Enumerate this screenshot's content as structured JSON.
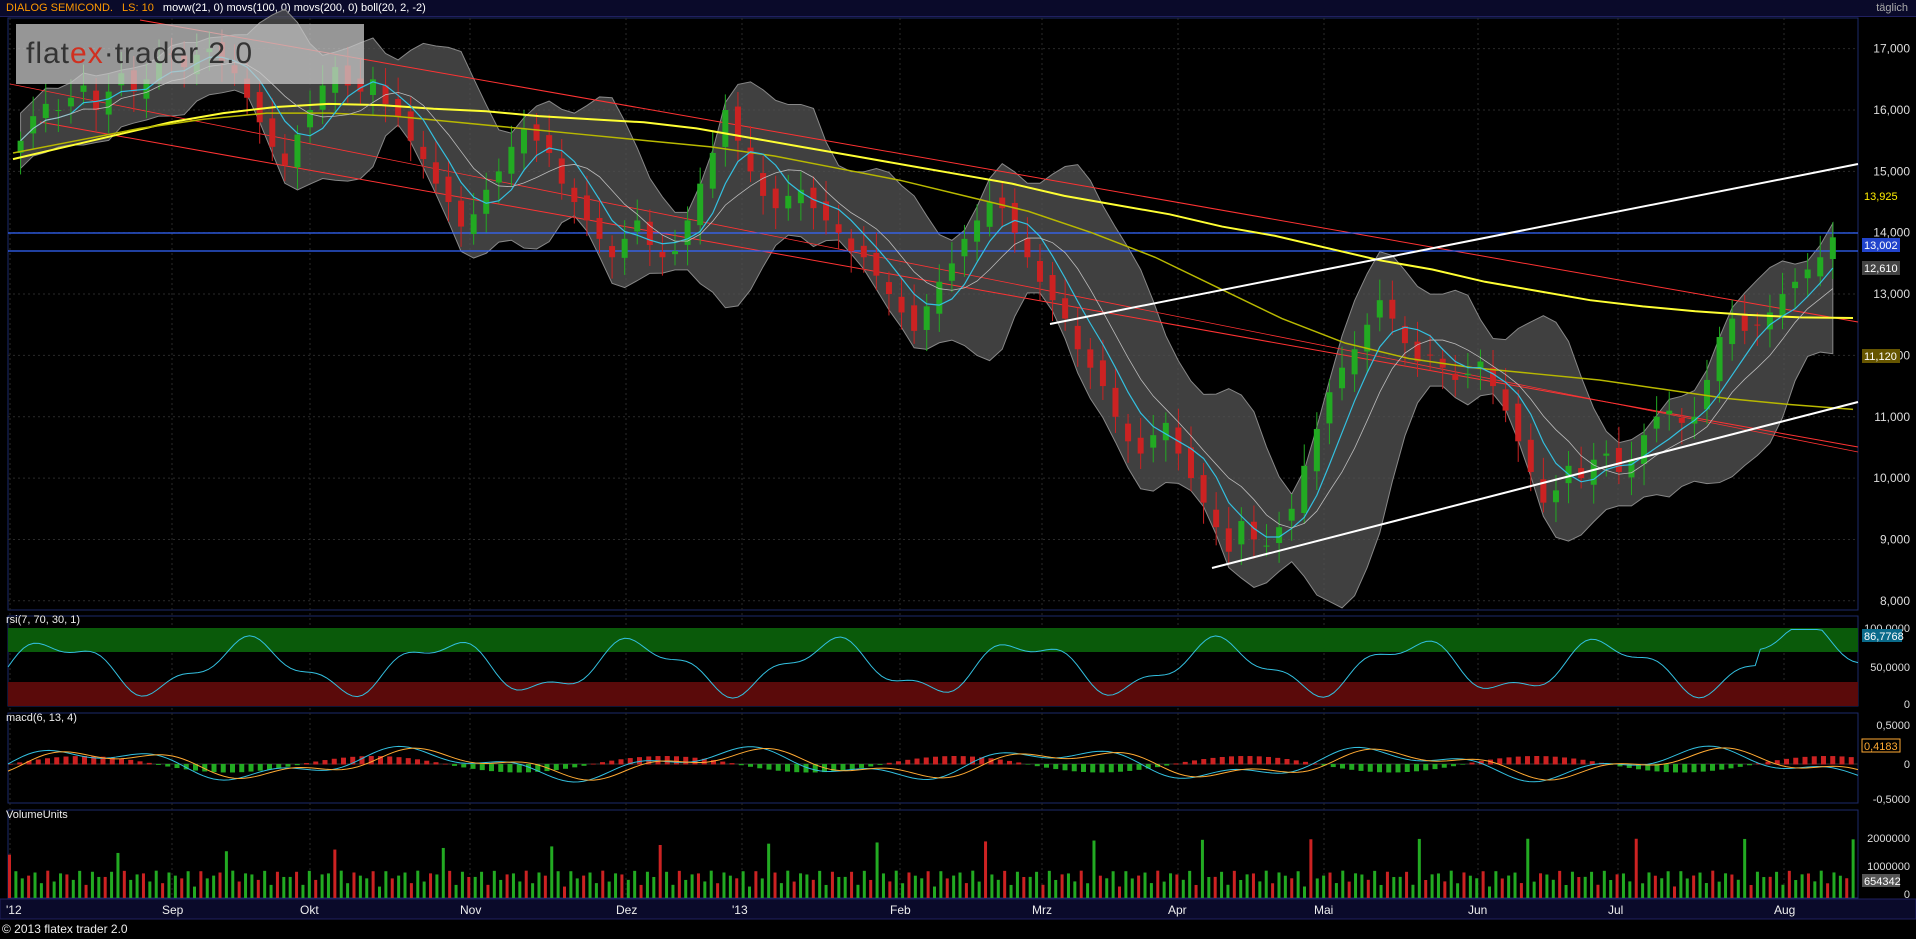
{
  "header": {
    "symbol": "DIALOG SEMICOND.",
    "ls": "LS: 10",
    "indicators": "movw(21, 0) movs(100, 0) movs(200, 0) boll(20, 2, -2)",
    "frequency": "täglich"
  },
  "logo": {
    "part1": "flat",
    "part2": "ex",
    "part3": "·trader 2.0"
  },
  "footer": "© 2013 flatex trader 2.0",
  "colors": {
    "up": "#22aa22",
    "down": "#cc2222",
    "sma100": "#b8b800",
    "sma200": "#ffff33",
    "wma21": "#33c0e0",
    "channel": "#ff3333",
    "hline": "#3366ff",
    "trend": "#ffffff"
  },
  "panels": {
    "rsi": {
      "label": "rsi(7, 70, 30, 1)",
      "ticks": [
        "50,0000",
        "0"
      ],
      "top_tick": "100,0000",
      "value": "86,7768"
    },
    "macd": {
      "label": "macd(6, 13, 4)",
      "ticks": [
        "0,5000",
        "0",
        "-0,5000"
      ],
      "value": "0,4183"
    },
    "volume": {
      "label": "VolumeUnits",
      "ticks": [
        "2000000",
        "1000000",
        "0"
      ],
      "value": "654342"
    }
  },
  "chart_data": {
    "type": "candlestick",
    "x_months": [
      "'12",
      "Sep",
      "Okt",
      "Nov",
      "Dez",
      "'13",
      "Feb",
      "Mrz",
      "Apr",
      "Mai",
      "Jun",
      "Jul",
      "Aug"
    ],
    "y_ticks": [
      "17,000",
      "16,000",
      "15,000",
      "14,000",
      "13,000",
      "12,000",
      "11,000",
      "10,000",
      "9,000",
      "8,000"
    ],
    "ylim": [
      7.85,
      17.5
    ],
    "price_labels": {
      "last": "13,925",
      "hline": "13,002",
      "sma200": "12,610",
      "sma100": "11,120"
    },
    "closes": [
      15.5,
      15.9,
      16.1,
      16.0,
      16.2,
      16.4,
      16.0,
      16.3,
      16.6,
      16.3,
      16.5,
      16.8,
      16.9,
      16.7,
      16.9,
      17.0,
      16.8,
      16.6,
      16.2,
      15.8,
      15.4,
      15.1,
      15.6,
      16.0,
      16.4,
      16.7,
      16.4,
      16.3,
      16.5,
      16.1,
      15.9,
      15.5,
      15.2,
      14.8,
      14.5,
      14.1,
      14.3,
      14.7,
      15.0,
      15.4,
      15.7,
      15.5,
      15.3,
      14.8,
      14.5,
      14.2,
      13.9,
      13.6,
      13.9,
      14.2,
      13.8,
      13.6,
      13.7,
      14.2,
      14.8,
      15.3,
      16.0,
      15.5,
      15.0,
      14.6,
      14.4,
      14.6,
      14.7,
      14.4,
      14.2,
      14.0,
      13.7,
      13.6,
      13.3,
      13.0,
      12.7,
      12.4,
      12.8,
      13.2,
      13.5,
      13.9,
      14.2,
      14.5,
      14.4,
      14.0,
      13.6,
      13.2,
      12.9,
      12.6,
      12.1,
      11.8,
      11.5,
      11.0,
      10.6,
      10.4,
      10.7,
      10.9,
      10.4,
      10.0,
      9.6,
      9.2,
      8.8,
      9.3,
      9.0,
      8.9,
      9.2,
      9.5,
      10.2,
      10.8,
      11.4,
      11.8,
      12.1,
      12.5,
      12.9,
      12.6,
      12.2,
      11.9,
      12.0,
      11.8,
      11.6,
      11.7,
      11.9,
      11.5,
      11.1,
      10.6,
      10.1,
      9.6,
      9.8,
      10.2,
      10.0,
      10.3,
      10.4,
      10.1,
      10.3,
      10.7,
      11.0,
      11.1,
      10.9,
      11.0,
      11.6,
      12.3,
      12.6,
      12.4,
      12.5,
      12.7,
      13.0,
      13.2,
      13.4,
      13.6,
      13.925
    ],
    "sma200": [
      15.2,
      15.4,
      15.6,
      15.8,
      15.95,
      16.05,
      16.1,
      16.08,
      16.02,
      15.98,
      15.9,
      15.85,
      15.8,
      15.7,
      15.55,
      15.4,
      15.25,
      15.1,
      14.95,
      14.8,
      14.6,
      14.45,
      14.3,
      14.1,
      13.95,
      13.75,
      13.55,
      13.4,
      13.2,
      13.05,
      12.9,
      12.8,
      12.72,
      12.66,
      12.62,
      12.61
    ],
    "sma100": [
      15.3,
      15.5,
      15.7,
      15.85,
      15.95,
      15.95,
      15.9,
      15.8,
      15.7,
      15.6,
      15.5,
      15.4,
      15.25,
      15.05,
      14.85,
      14.6,
      14.35,
      14.0,
      13.6,
      13.1,
      12.6,
      12.2,
      11.95,
      11.8,
      11.7,
      11.6,
      11.45,
      11.3,
      11.2,
      11.12
    ],
    "series": [
      {
        "name": "rsi(7, 70, 30, 1)",
        "ylim": [
          0,
          100
        ],
        "last": 86.78
      },
      {
        "name": "macd(6, 13, 4)",
        "ylim": [
          -0.7,
          0.7
        ],
        "last": 0.4183
      },
      {
        "name": "VolumeUnits",
        "ylim": [
          0,
          2600000
        ],
        "last": 654342
      }
    ]
  }
}
